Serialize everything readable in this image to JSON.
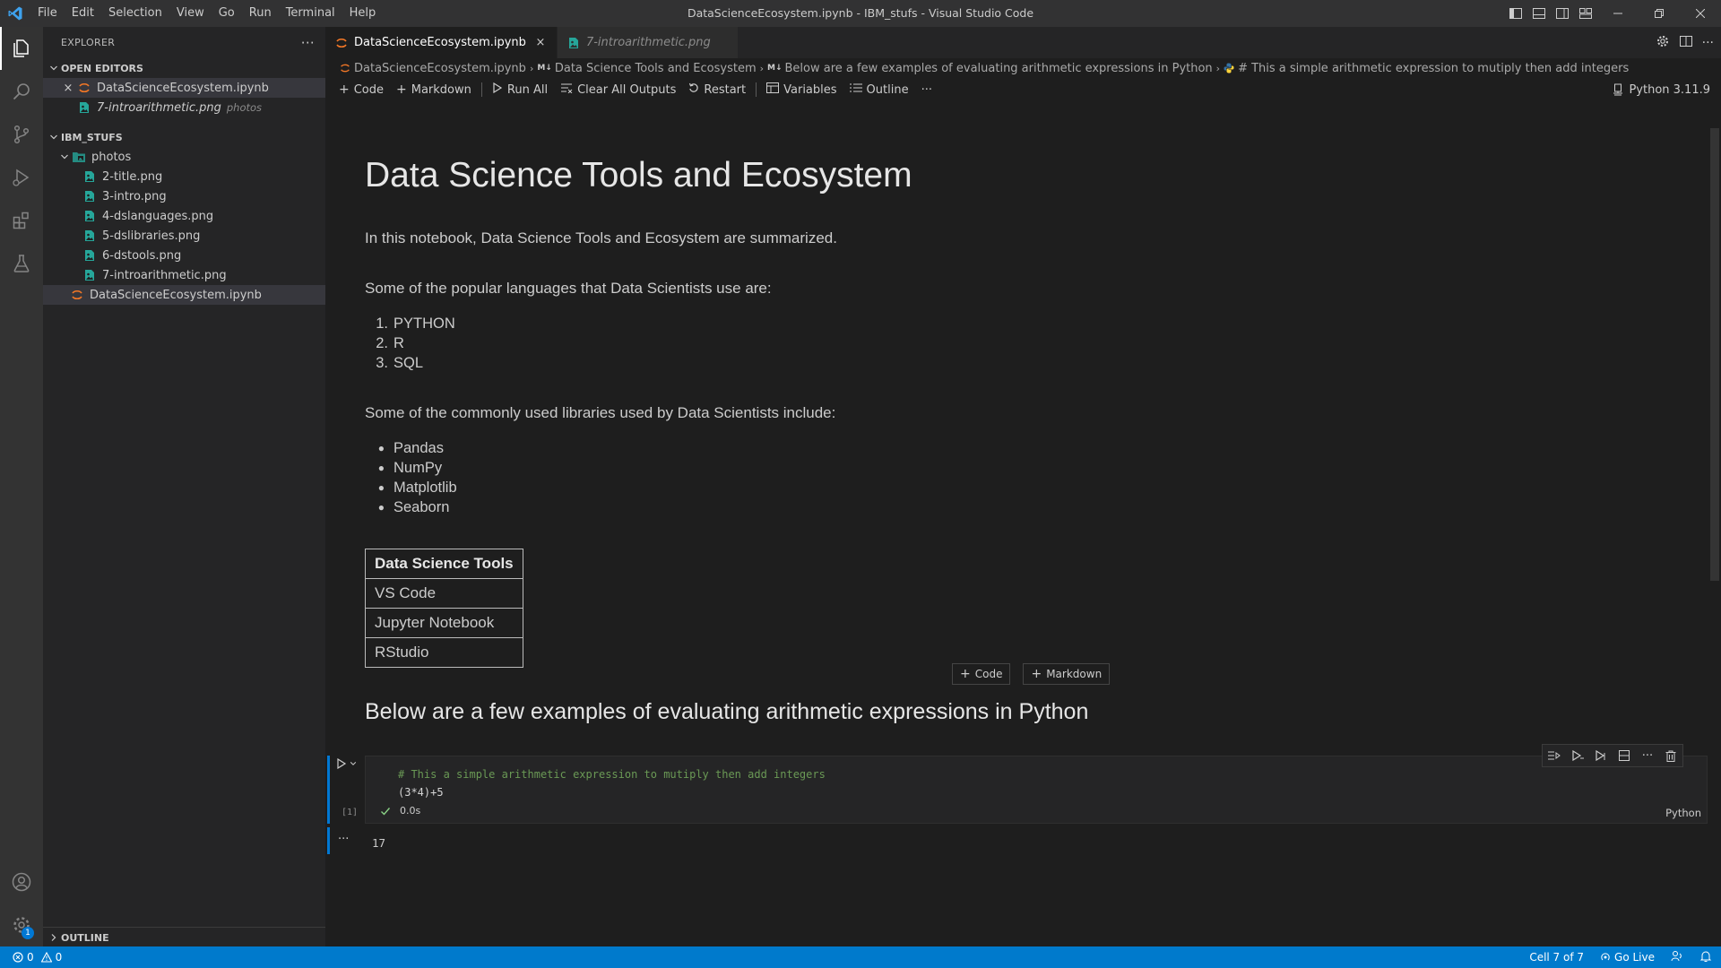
{
  "window": {
    "title": "DataScienceEcosystem.ipynb - IBM_stufs - Visual Studio Code",
    "menu": [
      "File",
      "Edit",
      "Selection",
      "View",
      "Go",
      "Run",
      "Terminal",
      "Help"
    ]
  },
  "sidebar": {
    "title": "EXPLORER",
    "open_editors_label": "OPEN EDITORS",
    "open_editors": [
      {
        "name": "DataScienceEcosystem.ipynb",
        "desc": ""
      },
      {
        "name": "7-introarithmetic.png",
        "desc": "photos"
      }
    ],
    "folder_label": "IBM_STUFS",
    "subfolder": "photos",
    "files": [
      "2-title.png",
      "3-intro.png",
      "4-dslanguages.png",
      "5-dslibraries.png",
      "6-dstools.png",
      "7-introarithmetic.png"
    ],
    "root_file": "DataScienceEcosystem.ipynb",
    "outline_label": "OUTLINE"
  },
  "tabs": [
    {
      "label": "DataScienceEcosystem.ipynb"
    },
    {
      "label": "7-introarithmetic.png"
    }
  ],
  "breadcrumb": {
    "file": "DataScienceEcosystem.ipynb",
    "md_prefix": "M↓",
    "h1": "Data Science Tools and Ecosystem",
    "h2": "Below are a few examples of evaluating arithmetic expressions in Python",
    "code": "# This a simple arithmetic expression to mutiply then add integers"
  },
  "toolbar": {
    "code": "Code",
    "markdown": "Markdown",
    "run_all": "Run All",
    "clear_outputs": "Clear All Outputs",
    "restart": "Restart",
    "variables": "Variables",
    "outline": "Outline",
    "more": "···",
    "kernel": "Python 3.11.9"
  },
  "notebook": {
    "title": "Data Science Tools and Ecosystem",
    "intro": "In this notebook, Data Science Tools and Ecosystem are summarized.",
    "languages_intro": "Some of the popular languages that Data Scientists use are:",
    "languages": [
      "PYTHON",
      "R",
      "SQL"
    ],
    "libraries_intro": "Some of the commonly used libraries used by Data Scientists include:",
    "libraries": [
      "Pandas",
      "NumPy",
      "Matplotlib",
      "Seaborn"
    ],
    "tools_header": "Data Science Tools",
    "tools": [
      "VS Code",
      "Jupyter Notebook",
      "RStudio"
    ],
    "add_code": "Code",
    "add_markdown": "Markdown",
    "arith_heading": "Below are a few examples of evaluating arithmetic expressions in Python",
    "cell": {
      "comment": "# This a simple arithmetic expression to mutiply then add integers",
      "code": "(3*4)+5",
      "exec_count": "[1]",
      "duration": "0.0s",
      "language": "Python",
      "output": "17",
      "output_dots": "···"
    }
  },
  "statusbar": {
    "errors": "0",
    "warnings": "0",
    "cell_position": "Cell 7 of 7",
    "go_live": "Go Live"
  },
  "colors": {
    "accent": "#007acc",
    "jupyter_orange": "#f37726",
    "image_icon": "#26a69a",
    "comment_green": "#6a9955"
  }
}
